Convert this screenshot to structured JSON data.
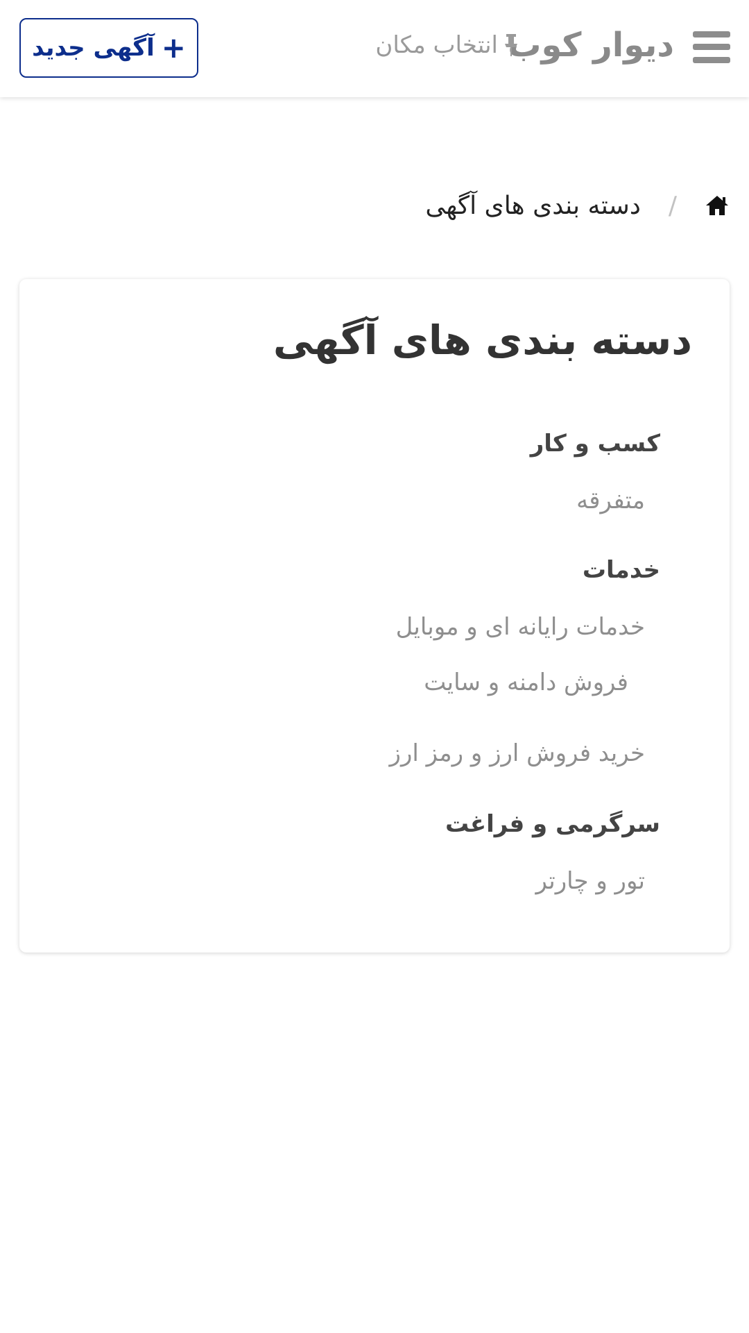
{
  "header": {
    "site_title": "دیوار کوب",
    "location_label": "انتخاب مکان",
    "new_ad_label": "آگهی جدید",
    "new_ad_icon": "+"
  },
  "breadcrumb": {
    "separator": "/",
    "current": "دسته بندی های آگهی"
  },
  "card": {
    "title": "دسته بندی های آگهی",
    "groups": [
      {
        "heading": "کسب و کار",
        "items": [
          "متفرقه"
        ]
      },
      {
        "heading": "خدمات",
        "items": [
          "خدمات رایانه ای و موبایل",
          "فروش دامنه و سایت",
          "خرید فروش ارز و رمز ارز"
        ]
      },
      {
        "heading": "سرگرمی و فراغت",
        "items": [
          "تور و چارتر"
        ]
      }
    ]
  },
  "colors": {
    "brand_blue": "#0d2e8c",
    "muted_text": "#8e8e8e",
    "heading_text": "#444444"
  },
  "icons": {
    "menu": "hamburger-icon",
    "location": "pin-icon",
    "home": "home-icon",
    "add": "plus-icon"
  }
}
